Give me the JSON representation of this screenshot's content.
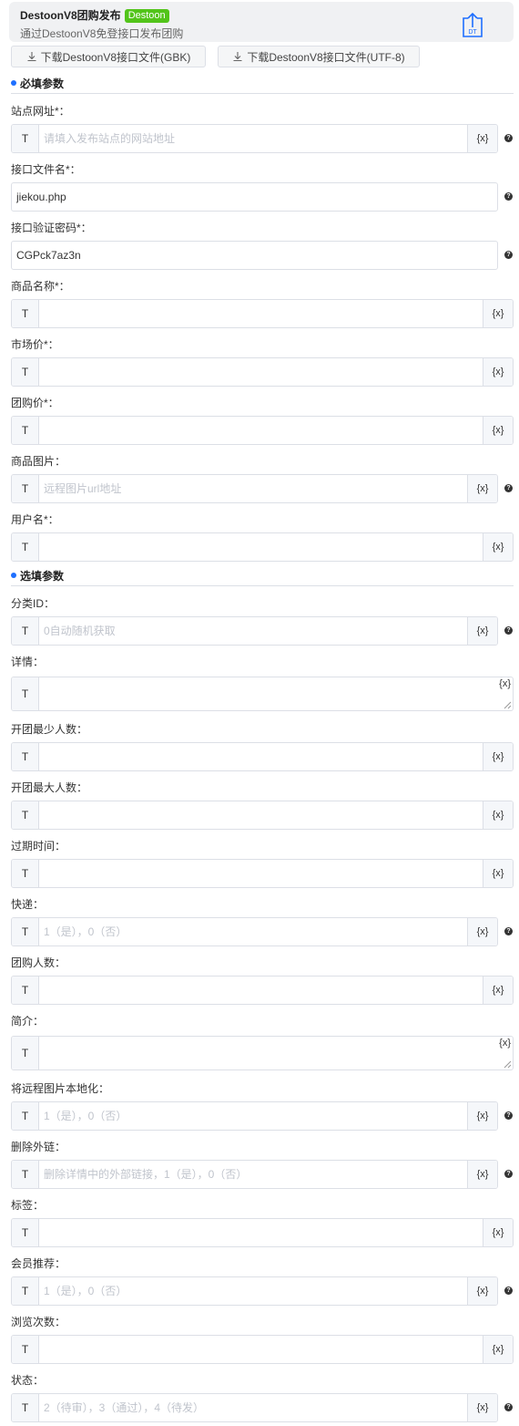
{
  "header": {
    "title": "DestoonV8团购发布",
    "tag": "Destoon",
    "subtitle": "通过DestoonV8免登接口发布团购",
    "icon_text": "DT"
  },
  "downloads": {
    "gbk_label": "下载DestoonV8接口文件(GBK)",
    "utf8_label": "下载DestoonV8接口文件(UTF-8)"
  },
  "sections": {
    "required": "必填参数",
    "optional": "选填参数"
  },
  "common": {
    "type_icon": "T",
    "var_label": "{x}",
    "help_glyph": "?"
  },
  "fields": {
    "site_url": {
      "label": "站点网址*：",
      "placeholder": "请填入发布站点的网站地址",
      "value": ""
    },
    "api_file": {
      "label": "接口文件名*：",
      "value": "jiekou.php"
    },
    "api_password": {
      "label": "接口验证密码*：",
      "value": "CGPck7az3n"
    },
    "product_name": {
      "label": "商品名称*：",
      "value": ""
    },
    "market_price": {
      "label": "市场价*：",
      "value": ""
    },
    "group_price": {
      "label": "团购价*：",
      "value": ""
    },
    "product_image": {
      "label": "商品图片：",
      "placeholder": "远程图片url地址",
      "value": ""
    },
    "username": {
      "label": "用户名*：",
      "value": ""
    },
    "category_id": {
      "label": "分类ID：",
      "placeholder": "0自动随机获取",
      "value": ""
    },
    "details": {
      "label": "详情：",
      "value": ""
    },
    "min_people": {
      "label": "开团最少人数：",
      "value": ""
    },
    "max_people": {
      "label": "开团最大人数：",
      "value": ""
    },
    "expire_time": {
      "label": "过期时间：",
      "value": ""
    },
    "express": {
      "label": "快递：",
      "placeholder": "1（是），0（否）",
      "value": ""
    },
    "group_count": {
      "label": "团购人数：",
      "value": ""
    },
    "intro": {
      "label": "简介：",
      "value": ""
    },
    "localize_images": {
      "label": "将远程图片本地化：",
      "placeholder": "1（是），0（否）",
      "value": ""
    },
    "remove_links": {
      "label": "删除外链：",
      "placeholder": "删除详情中的外部链接，1（是），0（否）",
      "value": ""
    },
    "tags": {
      "label": "标签：",
      "value": ""
    },
    "member_recommend": {
      "label": "会员推荐：",
      "placeholder": "1（是），0（否）",
      "value": ""
    },
    "view_count": {
      "label": "浏览次数：",
      "value": ""
    },
    "status": {
      "label": "状态：",
      "placeholder": "2（待审），3（通过），4（待发）",
      "value": ""
    }
  }
}
